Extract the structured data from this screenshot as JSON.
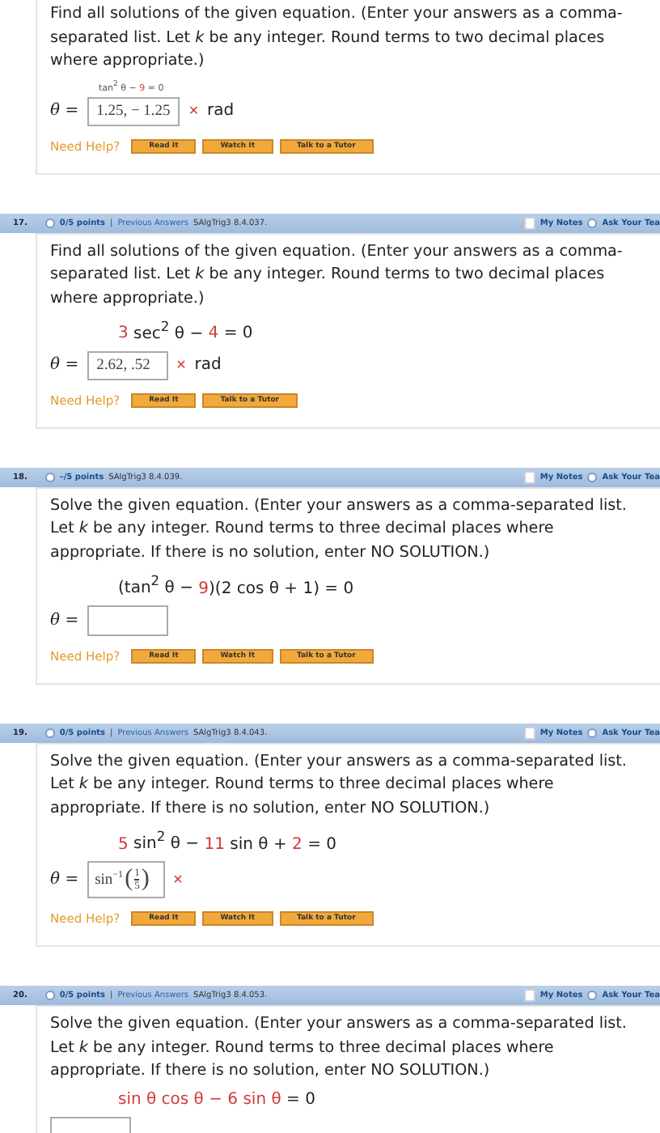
{
  "questions": [
    {
      "prompt": "Find all solutions of the given equation. (Enter your answers as a comma-separated list. Let *k* be any integer. Round terms to two decimal places where appropriate.)",
      "equation_small": true,
      "equation": [
        {
          "text": "tan$^{2}$ θ − ",
          "highlighted": false
        },
        {
          "text": "9",
          "highlighted": true
        },
        {
          "text": " = 0",
          "highlighted": false
        }
      ],
      "theta_label": "θ =",
      "answer": {
        "kind": "text",
        "value": "1.25, − 1.25",
        "mark": "✕",
        "unit": "rad"
      },
      "help_label": "Need Help?",
      "help_buttons": [
        "Read It",
        "Watch It",
        "Talk to a Tutor"
      ]
    },
    {
      "header": {
        "number": "17.",
        "points": "0/5 points",
        "separator": "|",
        "previous": "Previous Answers",
        "code": "SAlgTrig3 8.4.037.",
        "notes_checked": false,
        "notes": "My Notes",
        "ask": "Ask Your Tea"
      },
      "prompt": "Find all solutions of the given equation. (Enter your answers as a comma-separated list. Let *k* be any integer. Round terms to two decimal places where appropriate.)",
      "equation_small": false,
      "equation": [
        {
          "text": "3",
          "highlighted": true
        },
        {
          "text": " sec$^{2}$ θ − ",
          "highlighted": false
        },
        {
          "text": "4",
          "highlighted": true
        },
        {
          "text": " = 0",
          "highlighted": false
        }
      ],
      "theta_label": "θ =",
      "answer": {
        "kind": "text",
        "value": "2.62, .52",
        "mark": "✕",
        "unit": "rad"
      },
      "help_label": "Need Help?",
      "help_buttons": [
        "Read It",
        "Talk to a Tutor"
      ]
    },
    {
      "header": {
        "number": "18.",
        "points": "–/5 points",
        "code": "SAlgTrig3 8.4.039.",
        "notes_checked": false,
        "notes": "My Notes",
        "ask": "Ask Your Tea"
      },
      "prompt": "Solve the given equation. (Enter your answers as a comma-separated list. Let *k* be any integer. Round terms to three decimal places where appropriate. If there is no solution, enter NO SOLUTION.)",
      "equation_small": false,
      "equation": [
        {
          "text": "(tan$^{2}$ θ − ",
          "highlighted": false
        },
        {
          "text": "9",
          "highlighted": true
        },
        {
          "text": ")(2 cos θ + 1) = 0",
          "highlighted": false
        }
      ],
      "theta_label": "θ =",
      "answer": {
        "kind": "empty"
      },
      "help_label": "Need Help?",
      "help_buttons": [
        "Read It",
        "Watch It",
        "Talk to a Tutor"
      ]
    },
    {
      "header": {
        "number": "19.",
        "points": "0/5 points",
        "separator": "|",
        "previous": "Previous Answers",
        "code": "SAlgTrig3 8.4.043.",
        "notes_checked": false,
        "notes": "My Notes",
        "ask": "Ask Your Tea"
      },
      "prompt": "Solve the given equation. (Enter your answers as a comma-separated list. Let *k* be any integer. Round terms to three decimal places where appropriate. If there is no solution, enter NO SOLUTION.)",
      "equation_small": false,
      "equation": [
        {
          "text": "5",
          "highlighted": true
        },
        {
          "text": " sin$^{2}$ θ − ",
          "highlighted": false
        },
        {
          "text": "11",
          "highlighted": true
        },
        {
          "text": " sin θ + ",
          "highlighted": false
        },
        {
          "text": "2",
          "highlighted": true
        },
        {
          "text": " = 0",
          "highlighted": false
        }
      ],
      "theta_label": "θ =",
      "answer": {
        "kind": "inverse_fraction",
        "func": "sin",
        "exponent": "−1",
        "open": "(",
        "numerator": "1",
        "denominator": "5",
        "close": ")",
        "mark": "✕"
      },
      "help_label": "Need Help?",
      "help_buttons": [
        "Read It",
        "Watch It",
        "Talk to a Tutor"
      ]
    },
    {
      "header": {
        "number": "20.",
        "points": "0/5 points",
        "separator": "|",
        "previous": "Previous Answers",
        "code": "SAlgTrig3 8.4.053.",
        "notes_checked": false,
        "notes": "My Notes",
        "ask": "Ask Your Tea"
      },
      "prompt": "Solve the given equation. (Enter your answers as a comma-separated list. Let *k* be any integer. Round terms to three decimal places where appropriate. If there is no solution, enter NO SOLUTION.)",
      "equation_small": false,
      "equation": [
        {
          "text": "sin θ cos θ − 6 sin θ",
          "highlighted": true
        },
        {
          "text": " = 0",
          "highlighted": false
        }
      ],
      "answer": {
        "kind": "cut"
      }
    }
  ]
}
